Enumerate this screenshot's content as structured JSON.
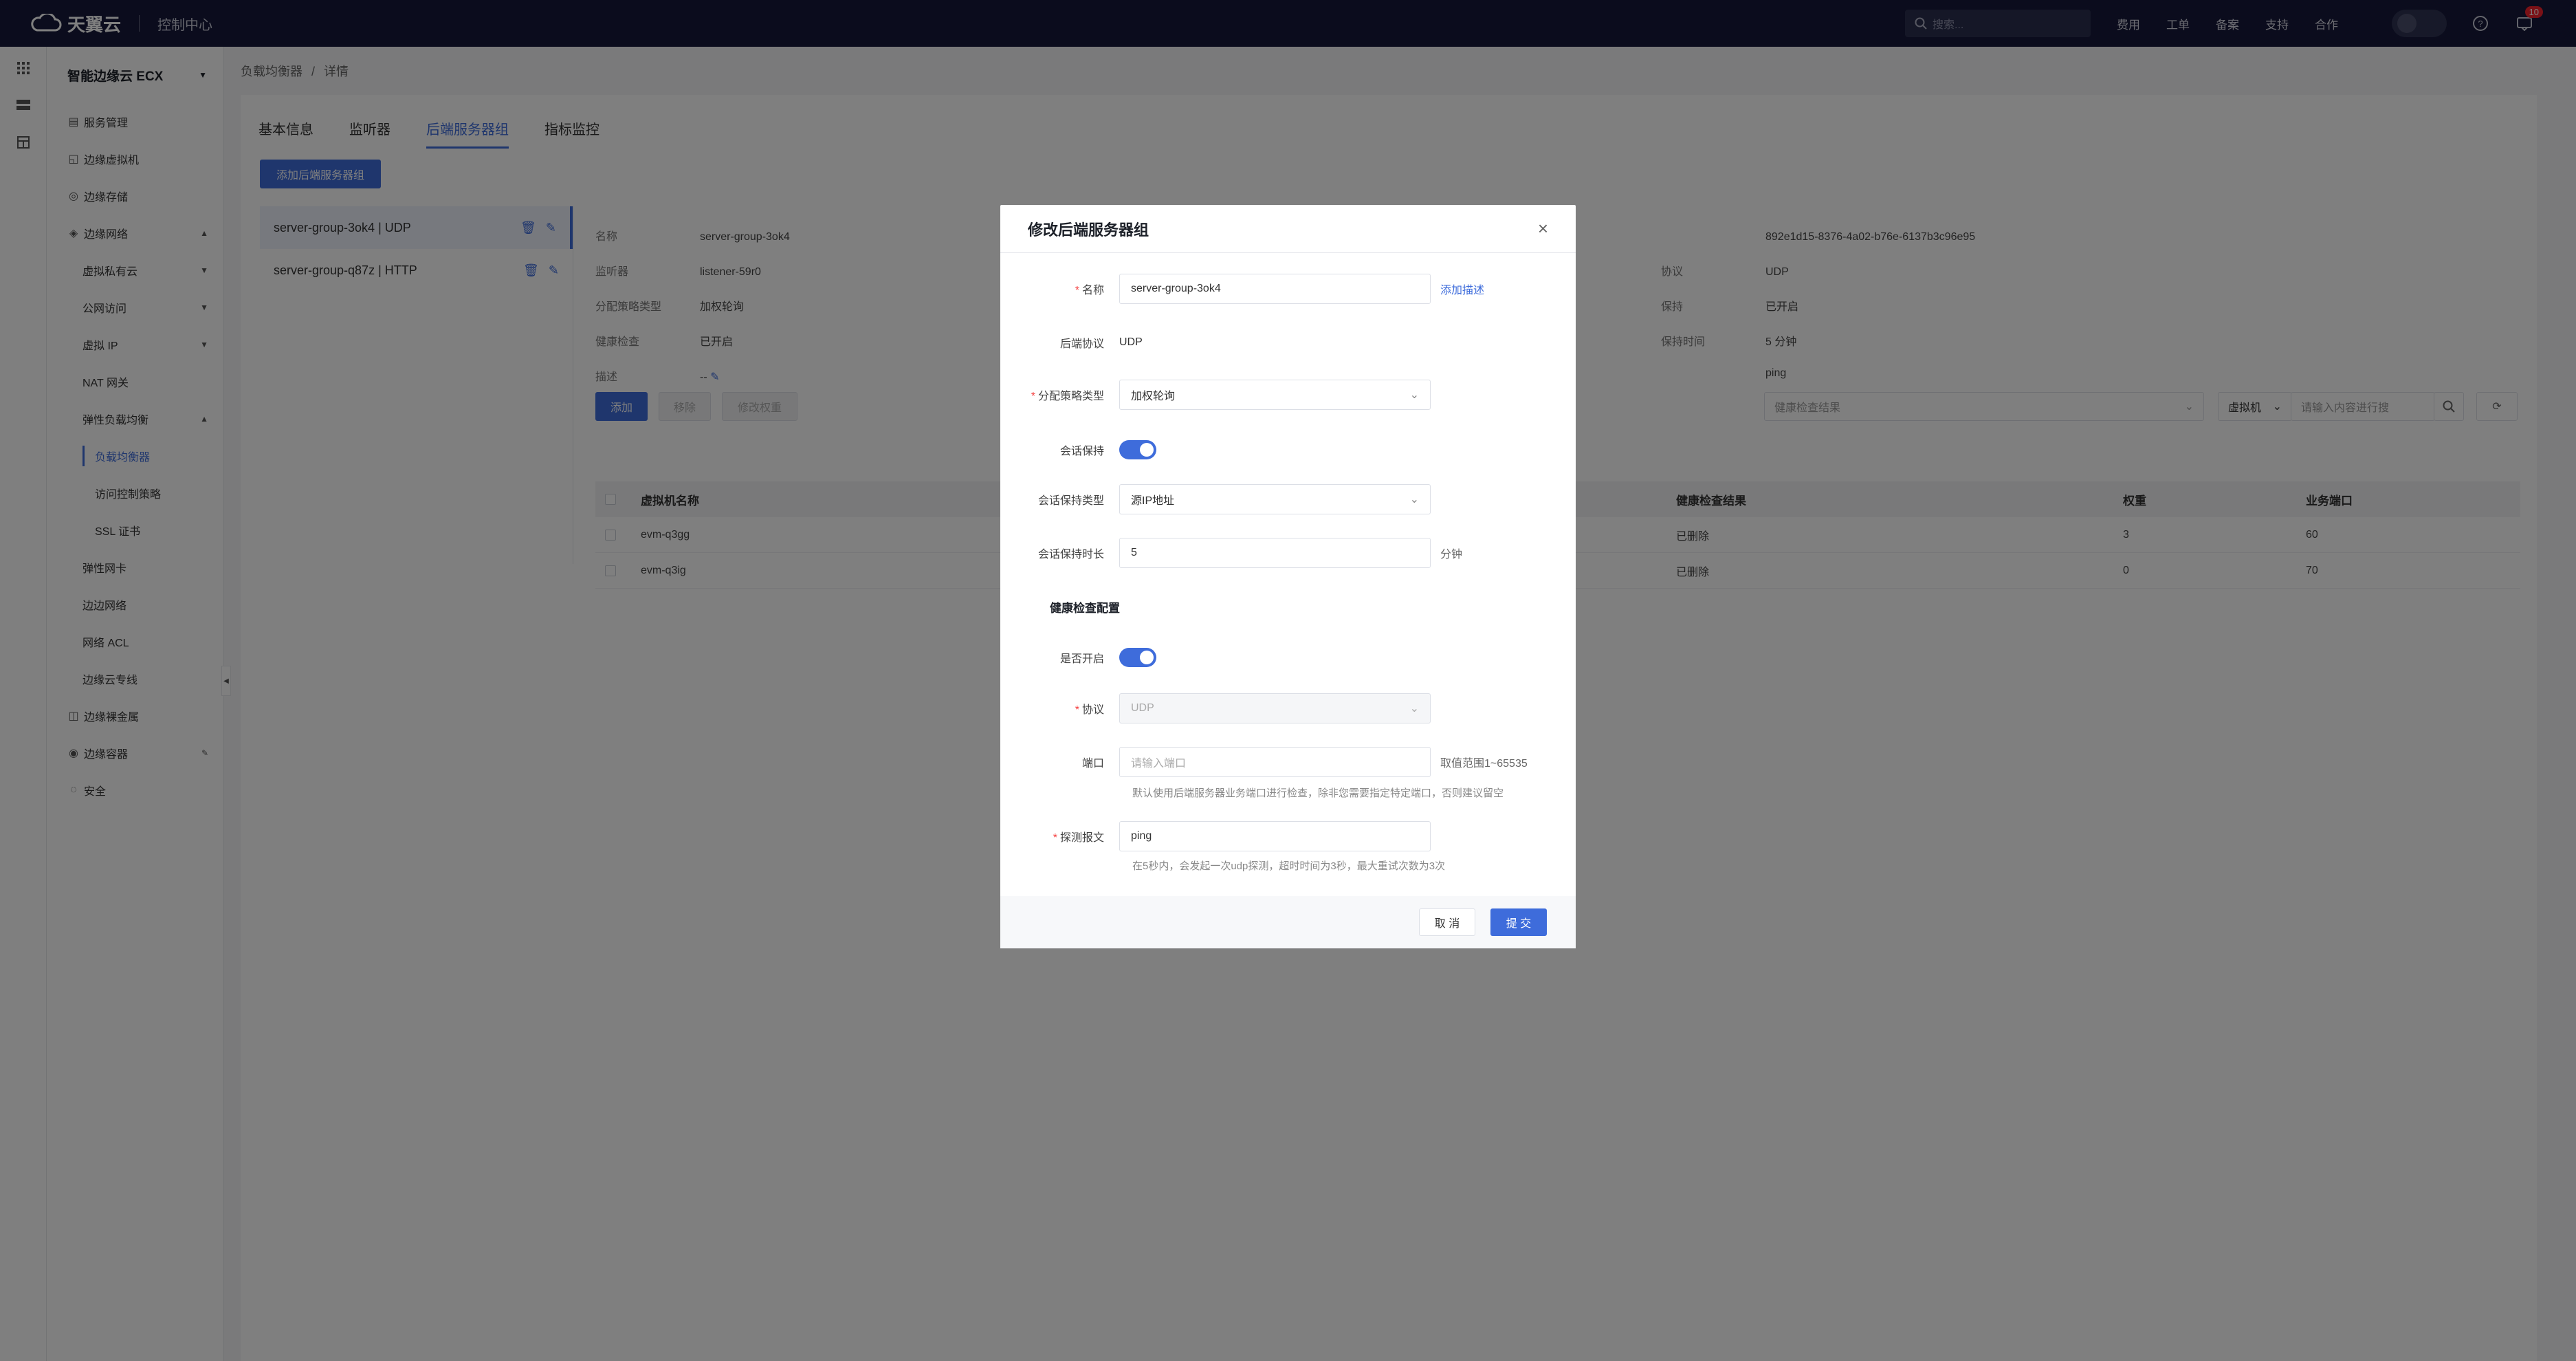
{
  "brand": {
    "name": "天翼云",
    "console": "控制中心"
  },
  "topbar": {
    "search_placeholder": "搜索...",
    "nav": [
      "费用",
      "工单",
      "备案",
      "支持",
      "合作"
    ],
    "badge_count": "10"
  },
  "sidebar": {
    "title": "智能边缘云 ECX",
    "items": [
      {
        "label": "服务管理",
        "icon": "service-icon"
      },
      {
        "label": "边缘虚拟机",
        "icon": "vm-icon"
      },
      {
        "label": "边缘存储",
        "icon": "storage-icon"
      },
      {
        "label": "边缘网络",
        "icon": "network-icon"
      },
      {
        "label": "虚拟私有云"
      },
      {
        "label": "公网访问"
      },
      {
        "label": "虚拟 IP"
      },
      {
        "label": "NAT 网关"
      },
      {
        "label": "弹性负载均衡"
      },
      {
        "label": "负载均衡器"
      },
      {
        "label": "访问控制策略"
      },
      {
        "label": "SSL 证书"
      },
      {
        "label": "弹性网卡"
      },
      {
        "label": "边边网络"
      },
      {
        "label": "网络 ACL"
      },
      {
        "label": "边缘云专线"
      },
      {
        "label": "边缘裸金属",
        "icon": "baremetal-icon"
      },
      {
        "label": "边缘容器",
        "icon": "container-icon"
      },
      {
        "label": "安全",
        "icon": "security-icon"
      }
    ]
  },
  "breadcrumb": {
    "parent": "负载均衡器",
    "sep": "/",
    "current": "详情"
  },
  "tabs": [
    "基本信息",
    "监听器",
    "后端服务器组",
    "指标监控"
  ],
  "add_group_button": "添加后端服务器组",
  "groups": [
    {
      "name": "server-group-3ok4 | UDP"
    },
    {
      "name": "server-group-q87z | HTTP"
    }
  ],
  "details_left": [
    {
      "k": "名称",
      "v": "server-group-3ok4"
    },
    {
      "k": "监听器",
      "v": "listener-59r0"
    },
    {
      "k": "分配策略类型",
      "v": "加权轮询"
    },
    {
      "k": "健康检查",
      "v": "已开启"
    },
    {
      "k": "描述",
      "v": "--"
    }
  ],
  "details_right": [
    {
      "k": "",
      "v": "892e1d15-8376-4a02-b76e-6137b3c96e95"
    },
    {
      "k": "协议",
      "v": "UDP"
    },
    {
      "k": "保持",
      "v": "已开启"
    },
    {
      "k": "保持时间",
      "v": "5 分钟"
    },
    {
      "k": "",
      "v": "ping"
    }
  ],
  "actions": {
    "add": "添加",
    "remove": "移除",
    "edit_weight": "修改权重"
  },
  "filters": {
    "health": "健康检查结果",
    "type": "虚拟机",
    "search_placeholder": "请输入内容进行搜",
    "search": "搜"
  },
  "table": {
    "headers": [
      "虚拟机名称",
      "健康检查结果",
      "权重",
      "业务端口"
    ],
    "rows": [
      {
        "name": "evm-q3gg",
        "health": "已删除",
        "weight": "3",
        "port": "60"
      },
      {
        "name": "evm-q3ig",
        "health": "已删除",
        "weight": "0",
        "port": "70"
      }
    ]
  },
  "modal": {
    "title": "修改后端服务器组",
    "name_label": "名称",
    "name_value": "server-group-3ok4",
    "add_desc": "添加描述",
    "protocol_label": "后端协议",
    "protocol_value": "UDP",
    "policy_label": "分配策略类型",
    "policy_value": "加权轮询",
    "session_label": "会话保持",
    "session_type_label": "会话保持类型",
    "session_type_value": "源IP地址",
    "session_time_label": "会话保持时长",
    "session_time_value": "5",
    "session_time_unit": "分钟",
    "health_section": "健康检查配置",
    "enabled_label": "是否开启",
    "hc_protocol_label": "协议",
    "hc_protocol_value": "UDP",
    "port_label": "端口",
    "port_placeholder": "请输入端口",
    "port_range": "取值范围1~65535",
    "port_hint": "默认使用后端服务器业务端口进行检查，除非您需要指定特定端口，否则建议留空",
    "probe_label": "探测报文",
    "probe_value": "ping",
    "probe_hint": "在5秒内，会发起一次udp探测，超时时间为3秒，最大重试次数为3次",
    "cancel": "取 消",
    "submit": "提 交"
  },
  "colors": {
    "primary": "#3e6cdb",
    "topbar": "#16193a",
    "required": "#f53f3f"
  }
}
